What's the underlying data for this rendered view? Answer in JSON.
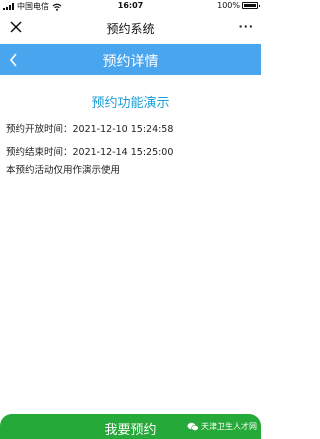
{
  "status_bar": {
    "carrier": "中国电信",
    "time": "16:07",
    "battery": "100%",
    "battery_level": 1.0
  },
  "wx_nav": {
    "title": "预约系统",
    "more": "···",
    "close_icon": "close-icon"
  },
  "app_header": {
    "title": "预约详情",
    "back_icon": "chevron-left-icon"
  },
  "content": {
    "title": "预约功能演示",
    "open_time": "预约开放时间：2021-12-10 15:24:58",
    "end_time": "预约结束时间：2021-12-14 15:25:00",
    "note": "本预约活动仅用作演示使用"
  },
  "footer": {
    "reserve_label": "我要预约"
  },
  "watermark": {
    "text": "天津卫生人才网"
  },
  "colors": {
    "header_blue": "#4aa5ef",
    "title_blue": "#1a9fd6",
    "button_green": "#25a938"
  }
}
